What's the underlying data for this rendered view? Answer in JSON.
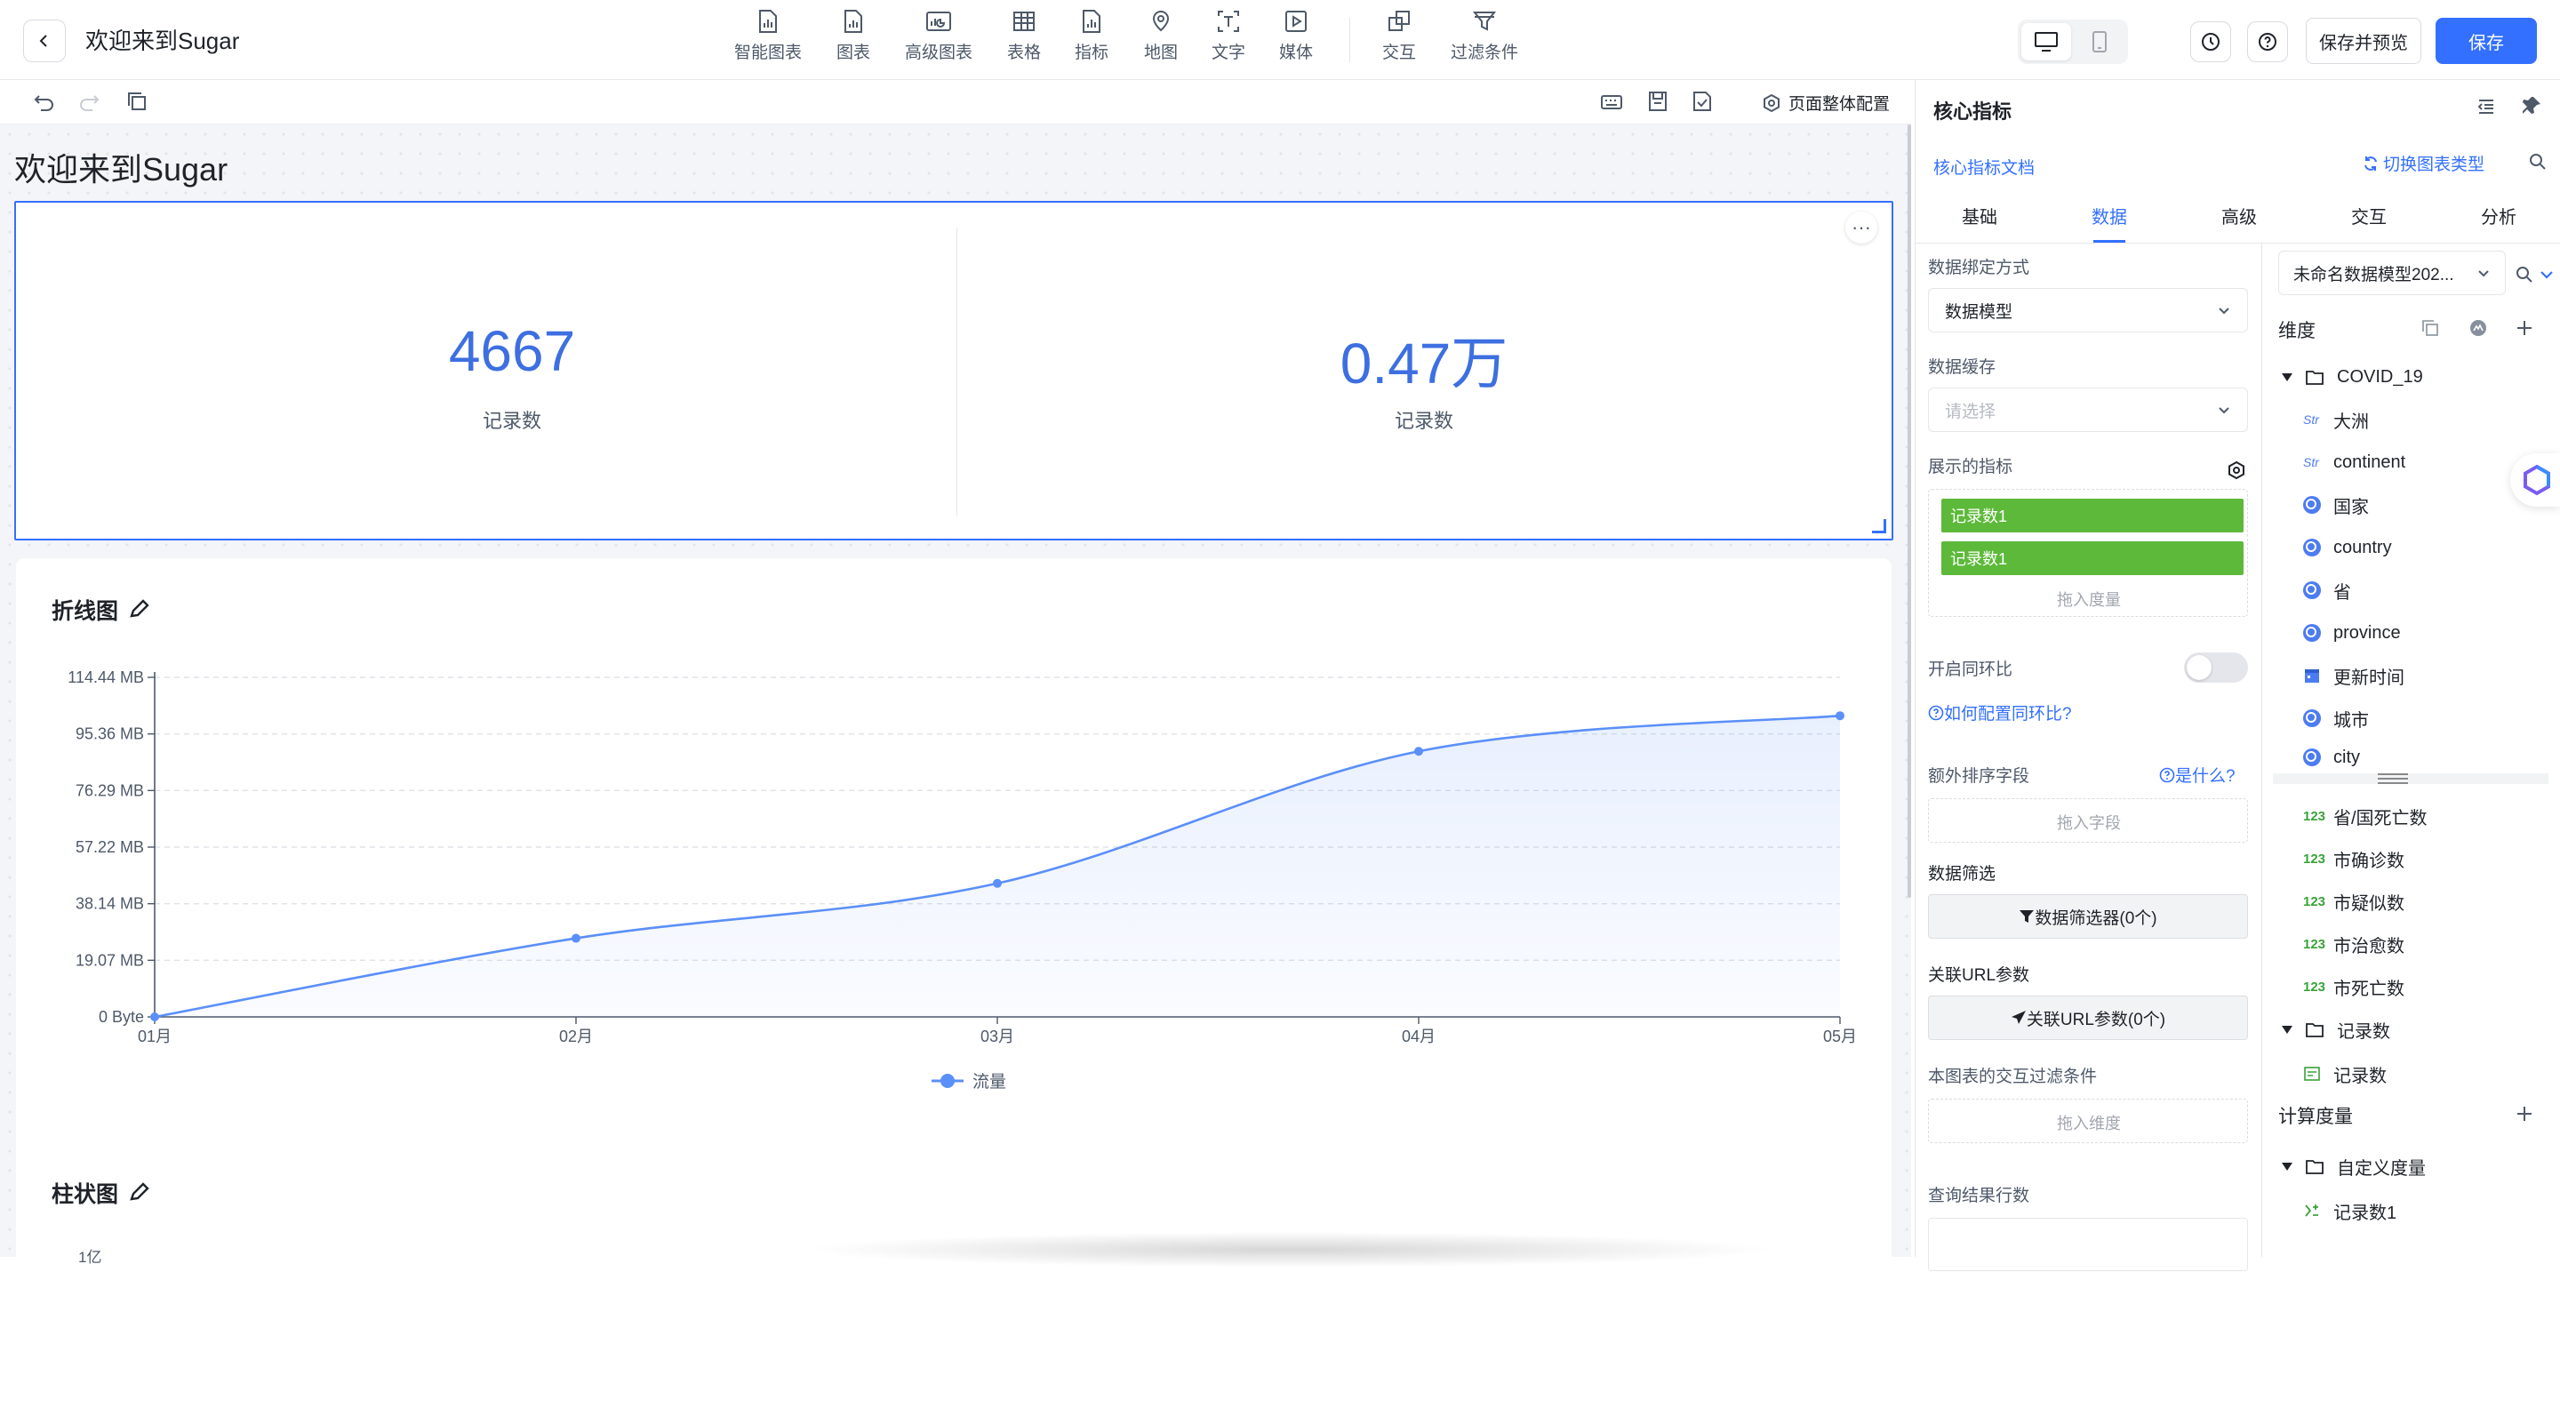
{
  "app": {
    "title": "欢迎来到Sugar"
  },
  "toolbar": {
    "items": [
      {
        "label": "智能图表",
        "icon": "smart-chart-icon"
      },
      {
        "label": "图表",
        "icon": "chart-icon"
      },
      {
        "label": "高级图表",
        "icon": "advanced-chart-icon"
      },
      {
        "label": "表格",
        "icon": "table-icon"
      },
      {
        "label": "指标",
        "icon": "metric-icon"
      },
      {
        "label": "地图",
        "icon": "map-icon"
      },
      {
        "label": "文字",
        "icon": "text-icon"
      },
      {
        "label": "媒体",
        "icon": "media-icon"
      },
      {
        "label": "交互",
        "icon": "interaction-icon"
      },
      {
        "label": "过滤条件",
        "icon": "filter-icon"
      }
    ],
    "save_preview": "保存并预览",
    "save": "保存"
  },
  "subbar": {
    "page_config": "页面整体配置"
  },
  "canvas": {
    "page_title": "欢迎来到Sugar",
    "kpi": [
      {
        "value": "4667",
        "label": "记录数"
      },
      {
        "value": "0.47万",
        "label": "记录数"
      }
    ],
    "more": "···",
    "line_title": "折线图",
    "bar_title": "柱状图",
    "bar_partial_tick": "1亿"
  },
  "chart_data": {
    "type": "area",
    "title": "折线图",
    "categories": [
      "01月",
      "02月",
      "03月",
      "04月",
      "05月"
    ],
    "series": [
      {
        "name": "流量",
        "values": [
          0,
          26.5,
          45,
          89.5,
          101.5
        ],
        "color": "#5b8ff9"
      }
    ],
    "y_ticks": [
      "0 Byte",
      "19.07 MB",
      "38.14 MB",
      "57.22 MB",
      "76.29 MB",
      "95.36 MB",
      "114.44 MB"
    ],
    "ylim": [
      0,
      114.44
    ],
    "yunit": "MB",
    "grid": true,
    "legend": "bottom-center",
    "smooth": true
  },
  "panel": {
    "title": "核心指标",
    "doc_link": "核心指标文档",
    "switch_type": "切换图表类型",
    "tabs": [
      "基础",
      "数据",
      "高级",
      "交互",
      "分析"
    ],
    "active_tab": "数据",
    "bind_label": "数据绑定方式",
    "bind_value": "数据模型",
    "cache_label": "数据缓存",
    "cache_placeholder": "请选择",
    "metrics_label": "展示的指标",
    "metric_pills": [
      "记录数1",
      "记录数1"
    ],
    "drop_measure": "拖入度量",
    "yoy_label": "开启同环比",
    "yoy_help": "如何配置同环比?",
    "sort_label": "额外排序字段",
    "sort_help": "是什么?",
    "drop_field": "拖入字段",
    "filter_label": "数据筛选",
    "filter_btn": "数据筛选器(0个)",
    "url_label": "关联URL参数",
    "url_btn": "关联URL参数(0个)",
    "interact_label": "本图表的交互过滤条件",
    "drop_dim": "拖入维度",
    "rows_label": "查询结果行数"
  },
  "fields": {
    "dataset": "未命名数据模型202...",
    "dim_header": "维度",
    "dim_folder": "COVID_19",
    "dims": [
      {
        "type": "str",
        "name": "大洲"
      },
      {
        "type": "str",
        "name": "continent"
      },
      {
        "type": "geo",
        "name": "国家"
      },
      {
        "type": "geo",
        "name": "country"
      },
      {
        "type": "geo",
        "name": "省"
      },
      {
        "type": "geo",
        "name": "province"
      },
      {
        "type": "date",
        "name": "更新时间"
      },
      {
        "type": "geo",
        "name": "城市"
      },
      {
        "type": "geo",
        "name": "city"
      }
    ],
    "str_tag": "Str",
    "num_tag": "123",
    "measures": [
      "省/国死亡数",
      "市确诊数",
      "市疑似数",
      "市治愈数",
      "市死亡数"
    ],
    "count_folder": "记录数",
    "count_item": "记录数",
    "calc_header": "计算度量",
    "custom_folder": "自定义度量",
    "custom_item": "记录数1"
  }
}
